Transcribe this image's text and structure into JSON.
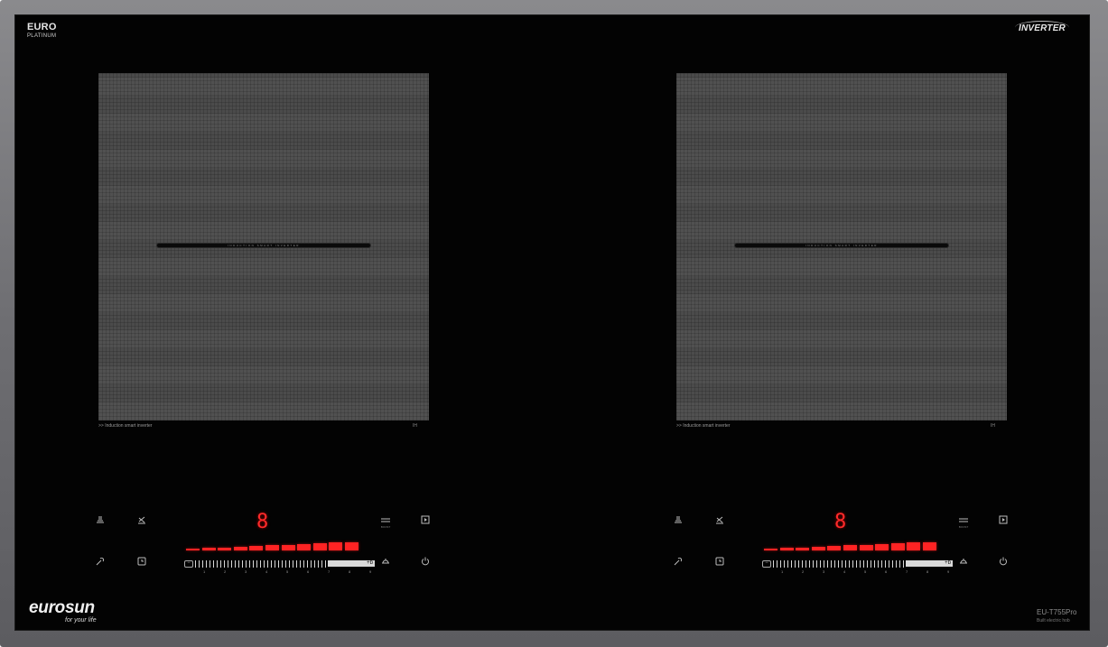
{
  "branding": {
    "top_left_line1": "EURO",
    "top_left_line2": "PLATINUM",
    "top_right": "INVERTER",
    "logo_name": "eurosun",
    "logo_tagline": "for your life",
    "model": "EU-T755Pro",
    "model_sub": "Built electric hob"
  },
  "zones": [
    {
      "bar_text": "INDUCTION SMART INVERTER",
      "caption": ">> Induction smart inverter",
      "mark": "IH"
    },
    {
      "bar_text": "INDUCTION SMART INVERTER",
      "caption": ">> Induction smart inverter",
      "mark": "IH"
    }
  ],
  "panels": [
    {
      "display_digit": "8",
      "power_level_fraction": 1.0,
      "boost_label": "+b",
      "minus_label": "−",
      "scale": [
        "1",
        "2",
        "3",
        "4",
        "5",
        "6",
        "7",
        "8",
        "9"
      ],
      "booster_label": "BOOST"
    },
    {
      "display_digit": "8",
      "power_level_fraction": 1.0,
      "boost_label": "+b",
      "minus_label": "−",
      "scale": [
        "1",
        "2",
        "3",
        "4",
        "5",
        "6",
        "7",
        "8",
        "9"
      ],
      "booster_label": "BOOST"
    }
  ],
  "icons": [
    "keep-warm-icon",
    "defrost-icon",
    "boost-icon",
    "pause-icon",
    "lock-icon",
    "timer-icon",
    "pan-icon",
    "power-icon"
  ],
  "colors": {
    "glass": "#030303",
    "zone": "#4b4b4b",
    "frame": "#7a7a7e",
    "display_red": "#ff2a2a"
  }
}
